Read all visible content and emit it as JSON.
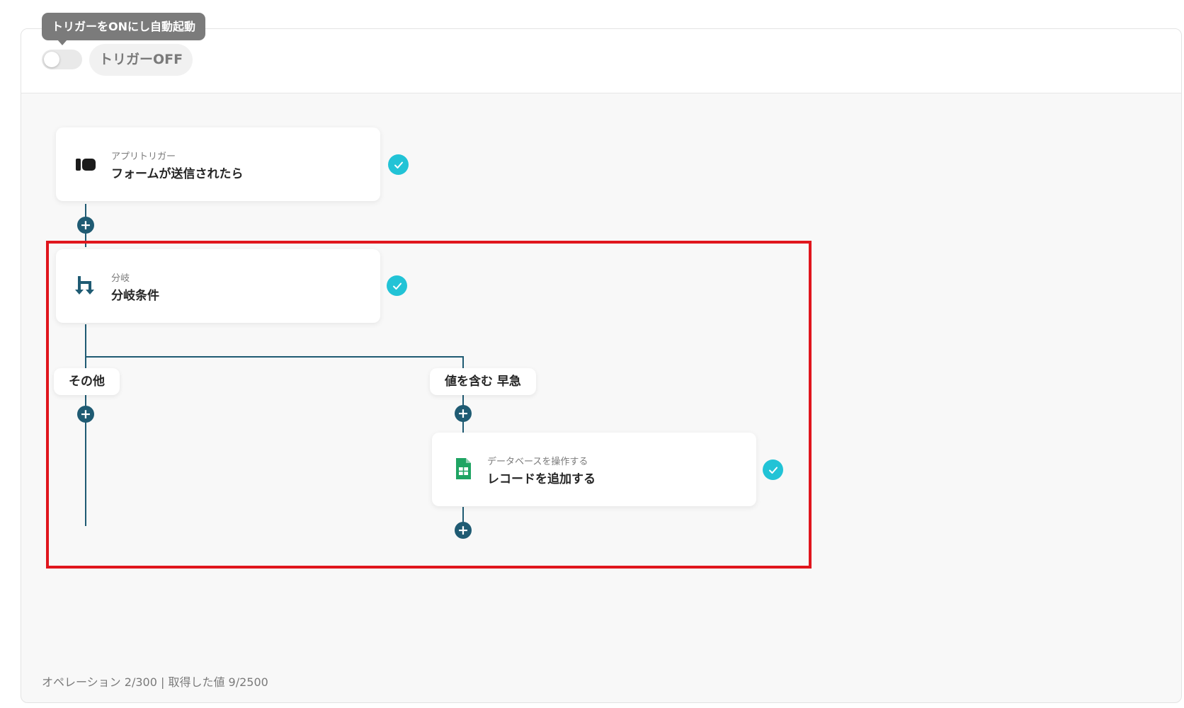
{
  "header": {
    "tooltip": "トリガーをONにし自動起動",
    "trigger_status": "トリガーOFF"
  },
  "nodes": {
    "trigger": {
      "subtitle": "アプリトリガー",
      "title": "フォームが送信されたら"
    },
    "branch": {
      "subtitle": "分岐",
      "title": "分岐条件"
    },
    "database": {
      "subtitle": "データベースを操作する",
      "title": "レコードを追加する"
    }
  },
  "branches": {
    "other": "その他",
    "contains": "値を含む 早急"
  },
  "footer": {
    "usage": "オペレーション 2/300 | 取得した値 9/2500"
  },
  "colors": {
    "accent": "#1f5b73",
    "check": "#22c3d6",
    "highlight": "#e0161d",
    "sheets_green": "#1fa463"
  }
}
